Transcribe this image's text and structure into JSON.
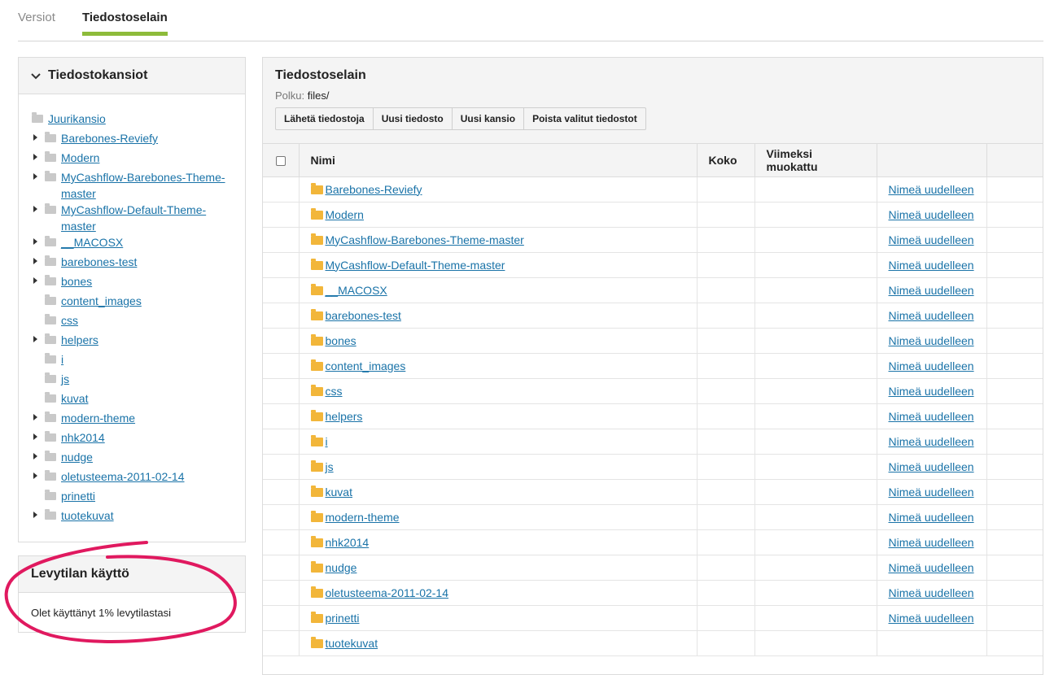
{
  "tabs": [
    {
      "label": "Versiot",
      "active": false
    },
    {
      "label": "Tiedostoselain",
      "active": true
    }
  ],
  "folders_panel": {
    "title": "Tiedostokansiot",
    "root": "Juurikansio",
    "items": [
      {
        "label": "Barebones-Reviefy",
        "expandable": true
      },
      {
        "label": "Modern",
        "expandable": true
      },
      {
        "label": "MyCashflow-Barebones-Theme-master",
        "expandable": true
      },
      {
        "label": "MyCashflow-Default-Theme-master",
        "expandable": true
      },
      {
        "label": "__MACOSX",
        "expandable": true
      },
      {
        "label": "barebones-test",
        "expandable": true
      },
      {
        "label": "bones",
        "expandable": true
      },
      {
        "label": "content_images",
        "expandable": false
      },
      {
        "label": "css",
        "expandable": false
      },
      {
        "label": "helpers",
        "expandable": true
      },
      {
        "label": "i",
        "expandable": false
      },
      {
        "label": "js",
        "expandable": false
      },
      {
        "label": "kuvat",
        "expandable": false
      },
      {
        "label": "modern-theme",
        "expandable": true
      },
      {
        "label": "nhk2014",
        "expandable": true
      },
      {
        "label": "nudge",
        "expandable": true
      },
      {
        "label": "oletusteema-2011-02-14",
        "expandable": true
      },
      {
        "label": "prinetti",
        "expandable": false
      },
      {
        "label": "tuotekuvat",
        "expandable": true
      }
    ]
  },
  "disk_usage": {
    "title": "Levytilan käyttö",
    "text": "Olet käyttänyt 1% levytilastasi"
  },
  "browser": {
    "title": "Tiedostoselain",
    "path_label": "Polku:",
    "path_value": "files/",
    "buttons": [
      "Lähetä tiedostoja",
      "Uusi tiedosto",
      "Uusi kansio",
      "Poista valitut tiedostot"
    ],
    "columns": {
      "name": "Nimi",
      "size": "Koko",
      "modified": "Viimeksi muokattu"
    },
    "rename_label": "Nimeä uudelleen",
    "rows": [
      "Barebones-Reviefy",
      "Modern",
      "MyCashflow-Barebones-Theme-master",
      "MyCashflow-Default-Theme-master",
      "__MACOSX",
      "barebones-test",
      "bones",
      "content_images",
      "css",
      "helpers",
      "i",
      "js",
      "kuvat",
      "modern-theme",
      "nhk2014",
      "nudge",
      "oletusteema-2011-02-14",
      "prinetti",
      "tuotekuvat"
    ]
  },
  "colors": {
    "accent": "#8dbb3a",
    "link": "#1a73a8",
    "annotation": "#e0195f",
    "folder": "#f2b63a"
  }
}
